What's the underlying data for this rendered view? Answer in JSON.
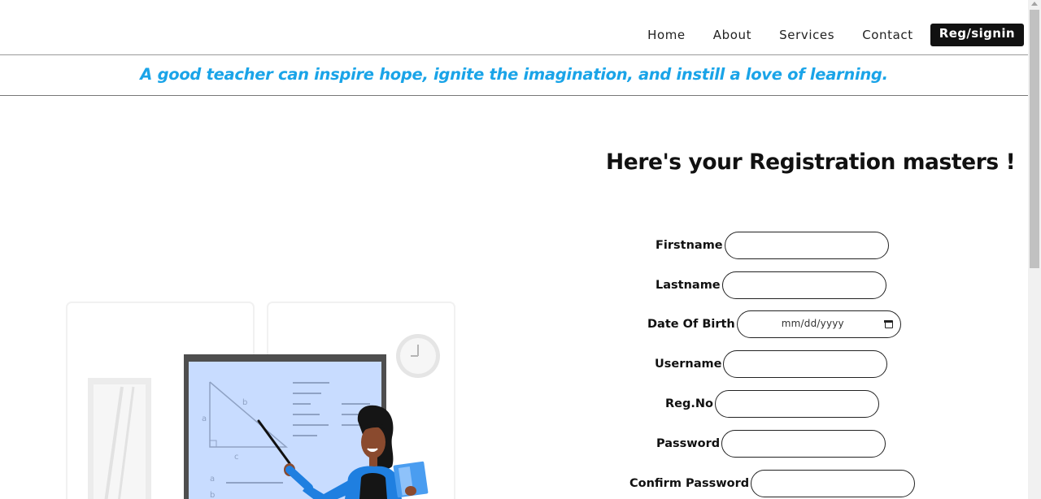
{
  "nav": {
    "items": [
      {
        "label": "Home"
      },
      {
        "label": "About"
      },
      {
        "label": "Services"
      },
      {
        "label": "Contact"
      }
    ],
    "cta_label": "Reg/signin"
  },
  "quote": "A good teacher can inspire hope, ignite the imagination, and instill a love of learning.",
  "heading": "Here's your Registration masters !",
  "form": {
    "fields": [
      {
        "label": "Firstname",
        "value": ""
      },
      {
        "label": "Lastname",
        "value": ""
      },
      {
        "label": "Date Of Birth",
        "placeholder": "mm/dd/yyyy"
      },
      {
        "label": "Username",
        "value": ""
      },
      {
        "label": "Reg.No",
        "value": ""
      },
      {
        "label": "Password",
        "value": ""
      },
      {
        "label": "Confirm Password",
        "value": ""
      }
    ]
  },
  "illustration": {
    "board_labels": [
      "a",
      "b",
      "c",
      "a",
      "b"
    ]
  },
  "colors": {
    "accent": "#1aa4e8",
    "nav_button_bg": "#111111",
    "board_fill": "#c8dcff",
    "shirt": "#1f7fe0"
  },
  "icons": [
    "calendar-icon",
    "clock-icon"
  ]
}
